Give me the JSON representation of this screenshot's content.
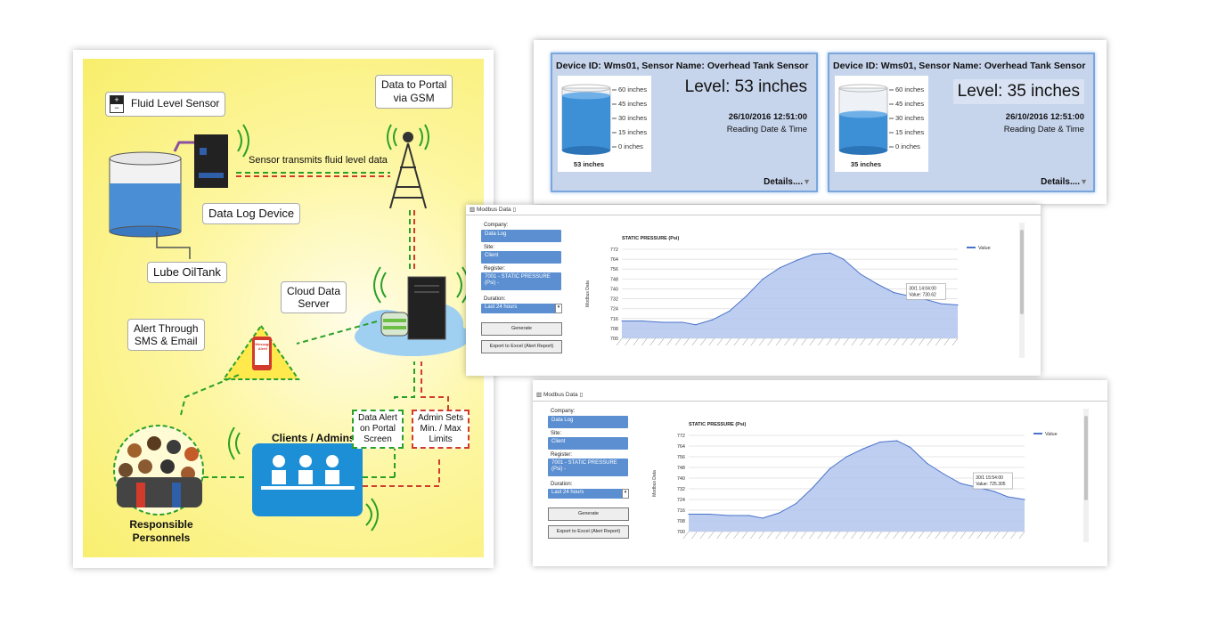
{
  "diagram": {
    "sensor_label": "Fluid Level Sensor",
    "sensor_plus": "+",
    "sensor_minus": "−",
    "transmit_label": "Sensor transmits fluid level data",
    "portal_label_l1": "Data to Portal",
    "portal_label_l2": "via GSM",
    "datalog_label": "Data Log Device",
    "tank_label": "Lube OilTank",
    "cloud_label_l1": "Cloud Data",
    "cloud_label_l2": "Server",
    "alert_label_l1": "Alert Through",
    "alert_label_l2": "SMS & Email",
    "phone_text_l1": "Message",
    "phone_text_l2": "Alert!",
    "clients_label": "Clients / Admins",
    "data_alert_l1": "Data Alert",
    "data_alert_l2": "on Portal",
    "data_alert_l3": "Screen",
    "admin_sets_l1": "Admin Sets",
    "admin_sets_l2": "Min. / Max",
    "admin_sets_l3": "Limits",
    "personnel_l1": "Responsible",
    "personnel_l2": "Personnels",
    "colors": {
      "green_link": "#2aa02a",
      "red_link": "#d23b2b",
      "background": "#f8ee6c"
    }
  },
  "devices": [
    {
      "title": "Device ID: Wms01, Sensor Name: Overhead Tank Sensor",
      "level_text": "Level: 53 inches",
      "tank_caption": "53 inches",
      "fill_fraction": 0.88,
      "date": "26/10/2016 12:51:00",
      "date_label": "Reading Date & Time",
      "details": "Details....",
      "ticks": [
        "60 inches",
        "45 inches",
        "30 inches",
        "15 inches",
        "0 inches"
      ]
    },
    {
      "title": "Device ID: Wms01, Sensor Name: Overhead Tank Sensor",
      "level_text": "Level: 35 inches",
      "tank_caption": "35 inches",
      "fill_fraction": 0.58,
      "date": "26/10/2016 12:51:00",
      "date_label": "Reading Date & Time",
      "details": "Details....",
      "ticks": [
        "60 inches",
        "45 inches",
        "30 inches",
        "15 inches",
        "0 inches"
      ]
    }
  ],
  "modbus": [
    {
      "header": "Modbus Data",
      "company_label": "Company:",
      "company_value": "Data Log",
      "site_label": "Site:",
      "site_value": "Client",
      "register_label": "Register:",
      "register_value_l1": "7001 - STATIC PRESSURE",
      "register_value_l2": "(Psi) -",
      "duration_label": "Duration:",
      "duration_value": "Last 24 hours",
      "generate": "Generate",
      "export": "Export to Excel (Alert Report)",
      "tooltip_time": "30/1 14:04:00",
      "tooltip_value_label": "Value:",
      "tooltip_value": "730.62"
    },
    {
      "header": "Modbus Data",
      "company_label": "Company:",
      "company_value": "Data Log",
      "site_label": "Site:",
      "site_value": "Client",
      "register_label": "Register:",
      "register_value_l1": "7001 - STATIC PRESSURE",
      "register_value_l2": "(Psi) -",
      "duration_label": "Duration:",
      "duration_value": "Last 24 hours",
      "generate": "Generate",
      "export": "Export to Excel (Alert Report)",
      "tooltip_time": "30/1 15:54:00",
      "tooltip_value_label": "Value:",
      "tooltip_value": "725.305"
    }
  ],
  "chart_data": [
    {
      "type": "area",
      "title": "STATIC PRESSURE (Psi)",
      "ylabel": "Modbus Data",
      "xlabel": "",
      "ylim": [
        700,
        772
      ],
      "yticks": [
        700,
        708,
        716,
        724,
        732,
        740,
        748,
        756,
        764,
        772
      ],
      "legend": "top-right",
      "series": [
        {
          "name": "Value",
          "x": [
            0,
            0.06,
            0.12,
            0.18,
            0.22,
            0.27,
            0.32,
            0.37,
            0.42,
            0.47,
            0.52,
            0.57,
            0.62,
            0.66,
            0.71,
            0.76,
            0.81,
            0.86,
            0.91,
            0.95,
            1.0
          ],
          "values": [
            714,
            714,
            713,
            713,
            711,
            715,
            722,
            734,
            748,
            757,
            763,
            768,
            769,
            764,
            752,
            744,
            737,
            734,
            731,
            728,
            727
          ]
        }
      ]
    },
    {
      "type": "area",
      "title": "STATIC PRESSURE (Psi)",
      "ylabel": "Modbus Data",
      "xlabel": "",
      "ylim": [
        700,
        772
      ],
      "yticks": [
        700,
        708,
        716,
        724,
        732,
        740,
        748,
        756,
        764,
        772
      ],
      "legend": "top-right",
      "series": [
        {
          "name": "Value",
          "x": [
            0,
            0.06,
            0.12,
            0.18,
            0.22,
            0.27,
            0.32,
            0.37,
            0.42,
            0.47,
            0.52,
            0.57,
            0.62,
            0.66,
            0.71,
            0.76,
            0.81,
            0.86,
            0.91,
            0.95,
            1.0
          ],
          "values": [
            713,
            713,
            712,
            712,
            710,
            714,
            721,
            733,
            747,
            756,
            762,
            767,
            768,
            763,
            751,
            743,
            736,
            733,
            730,
            726,
            724
          ]
        }
      ]
    }
  ]
}
